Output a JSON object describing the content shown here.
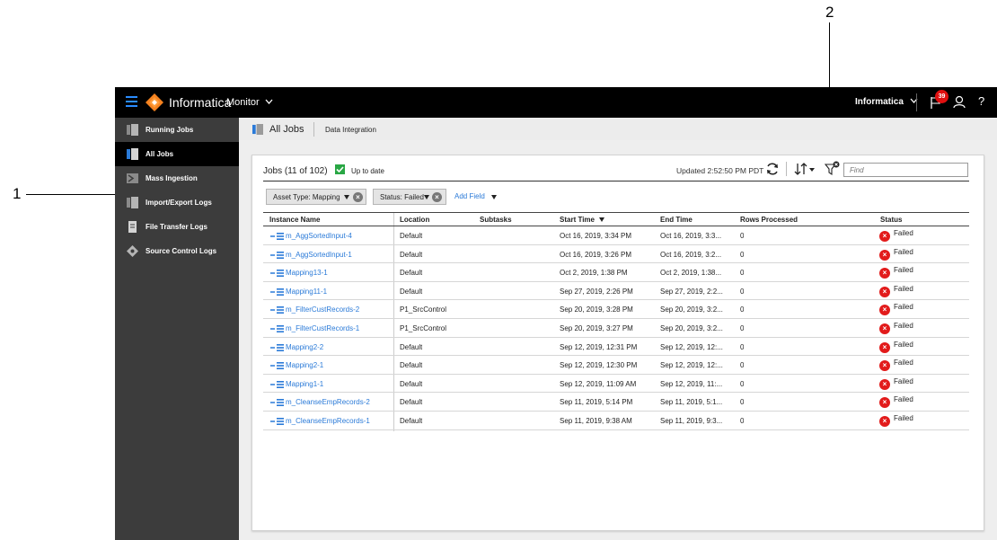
{
  "callouts": {
    "one": "1",
    "two": "2"
  },
  "topbar": {
    "brand": "Informatica",
    "app_switcher": "Monitor",
    "org": "Informatica",
    "notification_count": "39",
    "help": "?"
  },
  "sidebar": {
    "items": [
      {
        "label": "Running Jobs"
      },
      {
        "label": "All Jobs"
      },
      {
        "label": "Mass Ingestion"
      },
      {
        "label": "Import/Export Logs"
      },
      {
        "label": "File Transfer Logs"
      },
      {
        "label": "Source Control Logs"
      }
    ]
  },
  "breadcrumb": {
    "title": "All Jobs",
    "tab": "Data Integration"
  },
  "jobs": {
    "count_label": "Jobs (11 of 102)",
    "up_to_date": "Up to date",
    "updated": "Updated 2:52:50 PM PDT",
    "find_placeholder": "Find"
  },
  "filters": {
    "asset_type": "Asset Type: Mapping",
    "status": "Status: Failed",
    "add_field": "Add Field"
  },
  "table": {
    "headers": {
      "name": "Instance Name",
      "location": "Location",
      "subtasks": "Subtasks",
      "start": "Start Time",
      "end": "End Time",
      "rows": "Rows Processed",
      "status": "Status"
    },
    "rows": [
      {
        "name": "m_AggSortedInput-4",
        "location": "Default",
        "subtasks": "",
        "start": "Oct 16, 2019, 3:34 PM",
        "end": "Oct 16, 2019, 3:3...",
        "rows": "0",
        "status": "Failed"
      },
      {
        "name": "m_AggSortedInput-1",
        "location": "Default",
        "subtasks": "",
        "start": "Oct 16, 2019, 3:26 PM",
        "end": "Oct 16, 2019, 3:2...",
        "rows": "0",
        "status": "Failed"
      },
      {
        "name": "Mapping13-1",
        "location": "Default",
        "subtasks": "",
        "start": "Oct 2, 2019, 1:38 PM",
        "end": "Oct 2, 2019, 1:38...",
        "rows": "0",
        "status": "Failed"
      },
      {
        "name": "Mapping11-1",
        "location": "Default",
        "subtasks": "",
        "start": "Sep 27, 2019, 2:26 PM",
        "end": "Sep 27, 2019, 2:2...",
        "rows": "0",
        "status": "Failed"
      },
      {
        "name": "m_FilterCustRecords-2",
        "location": "P1_SrcControl",
        "subtasks": "",
        "start": "Sep 20, 2019, 3:28 PM",
        "end": "Sep 20, 2019, 3:2...",
        "rows": "0",
        "status": "Failed"
      },
      {
        "name": "m_FilterCustRecords-1",
        "location": "P1_SrcControl",
        "subtasks": "",
        "start": "Sep 20, 2019, 3:27 PM",
        "end": "Sep 20, 2019, 3:2...",
        "rows": "0",
        "status": "Failed"
      },
      {
        "name": "Mapping2-2",
        "location": "Default",
        "subtasks": "",
        "start": "Sep 12, 2019, 12:31 PM",
        "end": "Sep 12, 2019, 12:...",
        "rows": "0",
        "status": "Failed"
      },
      {
        "name": "Mapping2-1",
        "location": "Default",
        "subtasks": "",
        "start": "Sep 12, 2019, 12:30 PM",
        "end": "Sep 12, 2019, 12:...",
        "rows": "0",
        "status": "Failed"
      },
      {
        "name": "Mapping1-1",
        "location": "Default",
        "subtasks": "",
        "start": "Sep 12, 2019, 11:09 AM",
        "end": "Sep 12, 2019, 11:...",
        "rows": "0",
        "status": "Failed"
      },
      {
        "name": "m_CleanseEmpRecords-2",
        "location": "Default",
        "subtasks": "",
        "start": "Sep 11, 2019, 5:14 PM",
        "end": "Sep 11, 2019, 5:1...",
        "rows": "0",
        "status": "Failed"
      },
      {
        "name": "m_CleanseEmpRecords-1",
        "location": "Default",
        "subtasks": "",
        "start": "Sep 11, 2019, 9:38 AM",
        "end": "Sep 11, 2019, 9:3...",
        "rows": "0",
        "status": "Failed"
      }
    ]
  },
  "colors": {
    "accent": "#2a7ad8",
    "topbar": "#000000",
    "sidebar": "#3c3c3c",
    "failed": "#e21b1b",
    "ok": "#29a744"
  },
  "icons": [
    "hamburger-icon",
    "informatica-logo",
    "chevron-down-icon",
    "flag-icon",
    "user-icon",
    "help-icon",
    "refresh-icon",
    "sort-icon",
    "filter-icon",
    "mapping-icon",
    "failed-icon",
    "check-icon",
    "clear-icon"
  ]
}
